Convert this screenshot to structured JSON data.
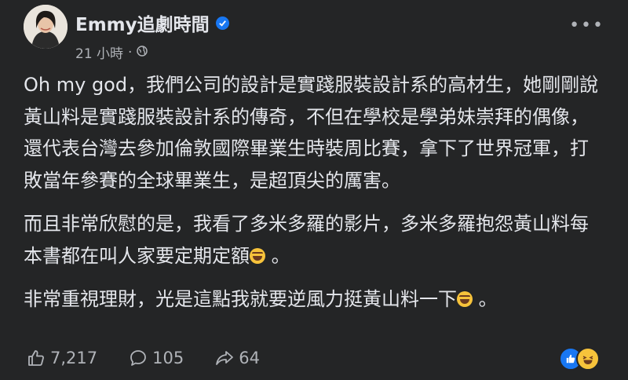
{
  "post": {
    "author": "Emmy追劇時間",
    "time": "21 小時",
    "separator": "·",
    "paragraphs": [
      "Oh my god，我們公司的設計是實踐服裝設計系的高材生，她剛剛說黃山料是實踐服裝設計系的傳奇，不但在學校是學弟妹崇拜的偶像，還代表台灣去參加倫敦國際畢業生時裝周比賽，拿下了世界冠軍，打敗當年參賽的全球畢業生，是超頂尖的厲害。",
      "而且非常欣慰的是，我看了多米多羅的影片，多米多羅抱怨黃山料每本書都在叫人家要定期定額",
      "非常重視理財，光是這點我就要逆風力挺黃山料一下"
    ],
    "paragraph_suffix": "。"
  },
  "stats": {
    "likes": "7,217",
    "comments": "105",
    "shares": "64"
  },
  "colors": {
    "background": "#242526",
    "text": "#e4e6eb",
    "secondary": "#b0b3b8",
    "verified": "#1877f2"
  },
  "icons": [
    "verified-badge-icon",
    "globe-icon",
    "more-options-icon",
    "laughing-emoji-icon",
    "like-icon",
    "comment-icon",
    "share-icon",
    "like-reaction-icon",
    "haha-reaction-icon"
  ]
}
